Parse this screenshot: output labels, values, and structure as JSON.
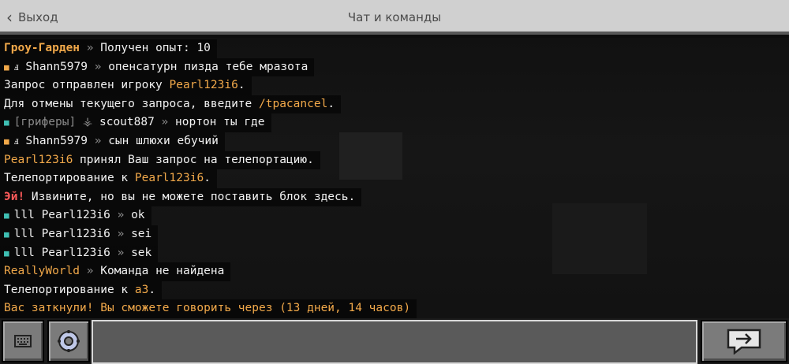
{
  "header": {
    "back_label": "Выход",
    "title": "Чат и команды"
  },
  "chat": {
    "l1": {
      "sender": "Гроу-Гарден",
      "sep": " » ",
      "text": "Получен опыт: 10"
    },
    "l2": {
      "rank": "ⅎ",
      "user": "Shann5979",
      "sep": " » ",
      "text": "опенсатурн пизда тебе мразота"
    },
    "l3": {
      "text": "Запрос отправлен игроку ",
      "player": "Pearl123i6",
      "end": "."
    },
    "l4": {
      "text": "Для отмены текущего запроса, введите ",
      "cmd": "/tpacancel",
      "end": "."
    },
    "l5": {
      "rank": "[гриферы] ⚶",
      "user": "scout887",
      "sep": " » ",
      "text": "нортон ты где"
    },
    "l6": {
      "rank": "ⅎ",
      "user": "Shann5979",
      "sep": " » ",
      "text": "сын шлюхи ебучий"
    },
    "l7": {
      "player": "Pearl123i6",
      "text": " принял Ваш запрос на телепортацию."
    },
    "l8": {
      "text": "Телепортирование к ",
      "player": "Pearl123i6",
      "end": "."
    },
    "l9": {
      "prefix": "Эй!",
      "text": " Извините, но вы не можете поставить блок здесь."
    },
    "l10": {
      "rank": "lll",
      "user": "Pearl123i6",
      "sep": " » ",
      "text": "ok"
    },
    "l11": {
      "rank": "lll",
      "user": "Pearl123i6",
      "sep": " » ",
      "text": "sei"
    },
    "l12": {
      "rank": "lll",
      "user": "Pearl123i6",
      "sep": " » ",
      "text": "sek"
    },
    "l13": {
      "sender": "ReallyWorld",
      "sep": " » ",
      "text": "Команда не найдена"
    },
    "l14": {
      "text": "Телепортирование к ",
      "player": "a3",
      "end": "."
    },
    "l15": {
      "text": "Вас заткнули! Вы сможете говорить через (13 дней, 14 часов)"
    }
  },
  "bottom": {
    "input_value": ""
  },
  "icons": {
    "square": "■",
    "back": "<"
  },
  "colors": {
    "accent": "#f2a94a",
    "alert": "#ff5a5a",
    "cyan": "#3fc0b4"
  }
}
